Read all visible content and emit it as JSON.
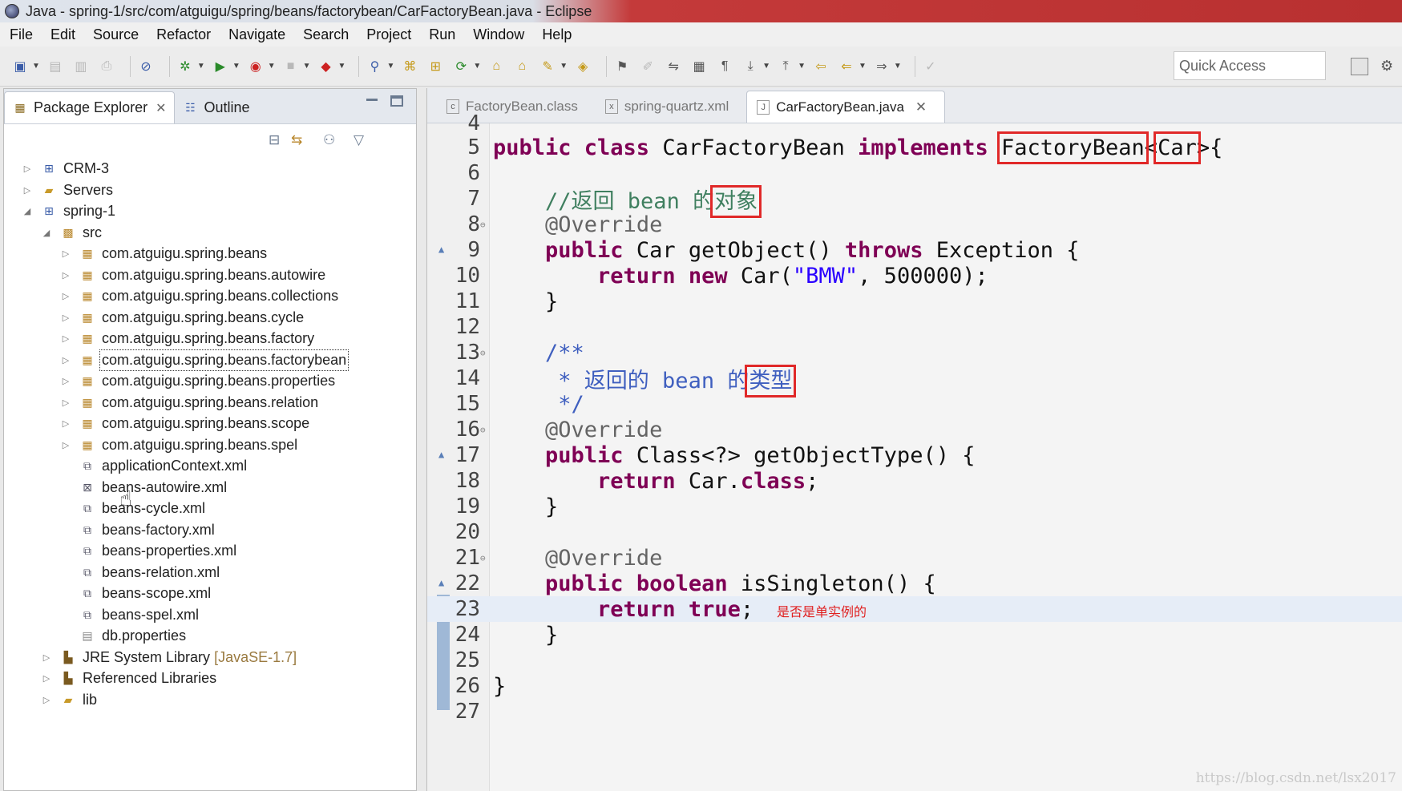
{
  "window": {
    "title": "Java - spring-1/src/com/atguigu/spring/beans/factorybean/CarFactoryBean.java - Eclipse"
  },
  "menu": [
    "File",
    "Edit",
    "Source",
    "Refactor",
    "Navigate",
    "Search",
    "Project",
    "Run",
    "Window",
    "Help"
  ],
  "toolbar": {
    "quick_access_placeholder": "Quick Access"
  },
  "left_panel": {
    "tabs": [
      {
        "label": "Package Explorer"
      },
      {
        "label": "Outline"
      }
    ],
    "tree": [
      {
        "label": "CRM-3",
        "icon": "java-project-icon"
      },
      {
        "label": "Servers",
        "icon": "folder-icon"
      },
      {
        "label": "spring-1",
        "icon": "java-project-icon"
      },
      {
        "label": "src",
        "icon": "source-folder-icon"
      },
      {
        "label": "com.atguigu.spring.beans",
        "icon": "package-icon"
      },
      {
        "label": "com.atguigu.spring.beans.autowire",
        "icon": "package-icon"
      },
      {
        "label": "com.atguigu.spring.beans.collections",
        "icon": "package-icon"
      },
      {
        "label": "com.atguigu.spring.beans.cycle",
        "icon": "package-icon"
      },
      {
        "label": "com.atguigu.spring.beans.factory",
        "icon": "package-icon"
      },
      {
        "label": "com.atguigu.spring.beans.factorybean",
        "icon": "package-icon"
      },
      {
        "label": "com.atguigu.spring.beans.properties",
        "icon": "package-icon"
      },
      {
        "label": "com.atguigu.spring.beans.relation",
        "icon": "package-icon"
      },
      {
        "label": "com.atguigu.spring.beans.scope",
        "icon": "package-icon"
      },
      {
        "label": "com.atguigu.spring.beans.spel",
        "icon": "package-icon"
      },
      {
        "label": "applicationContext.xml",
        "icon": "spring-xml-icon"
      },
      {
        "label": "beans-autowire.xml",
        "icon": "xml-file-icon"
      },
      {
        "label": "beans-cycle.xml",
        "icon": "spring-xml-icon"
      },
      {
        "label": "beans-factory.xml",
        "icon": "spring-xml-icon"
      },
      {
        "label": "beans-properties.xml",
        "icon": "spring-xml-icon"
      },
      {
        "label": "beans-relation.xml",
        "icon": "spring-xml-icon"
      },
      {
        "label": "beans-scope.xml",
        "icon": "spring-xml-icon"
      },
      {
        "label": "beans-spel.xml",
        "icon": "spring-xml-icon"
      },
      {
        "label": "db.properties",
        "icon": "properties-file-icon"
      },
      {
        "label": "JRE System Library",
        "suffix": "[JavaSE-1.7]",
        "icon": "library-icon"
      },
      {
        "label": "Referenced Libraries",
        "icon": "library-icon"
      },
      {
        "label": "lib",
        "icon": "folder-icon"
      }
    ]
  },
  "editor": {
    "tabs": [
      {
        "label": "FactoryBean.class"
      },
      {
        "label": "spring-quartz.xml"
      },
      {
        "label": "CarFactoryBean.java"
      }
    ],
    "line_numbers": [
      "4",
      "5",
      "6",
      "7",
      "8",
      "9",
      "10",
      "11",
      "12",
      "13",
      "14",
      "15",
      "16",
      "17",
      "18",
      "19",
      "20",
      "21",
      "22",
      "23",
      "24",
      "25",
      "26",
      "27"
    ],
    "code": {
      "l5": [
        "public class ",
        "CarFactoryBean ",
        "implements ",
        "FactoryBean",
        "<",
        "Car",
        ">{"
      ],
      "l7": "//返回 bean 的",
      "l7b": "对象",
      "l8": "@Override",
      "l9": [
        "public ",
        "Car getObject() ",
        "throws ",
        "Exception {"
      ],
      "l10": [
        "return new ",
        "Car(",
        "\"BMW\"",
        ", 500000);"
      ],
      "l11": "}",
      "l13": "/**",
      "l14": " * 返回的 bean 的",
      "l14b": "类型",
      "l15": " */",
      "l16": "@Override",
      "l17": [
        "public ",
        "Class<?> getObjectType() {"
      ],
      "l18": [
        "return ",
        "Car.",
        ";"
      ],
      "l18kw": "class",
      "l19": "}",
      "l21": "@Override",
      "l22": [
        "public boolean ",
        "isSingleton() {"
      ],
      "l23": [
        "return true",
        ";"
      ],
      "l23note": "是否是单实例的",
      "l24": "}",
      "l26": "}"
    }
  },
  "watermark": "https://blog.csdn.net/lsx2017"
}
